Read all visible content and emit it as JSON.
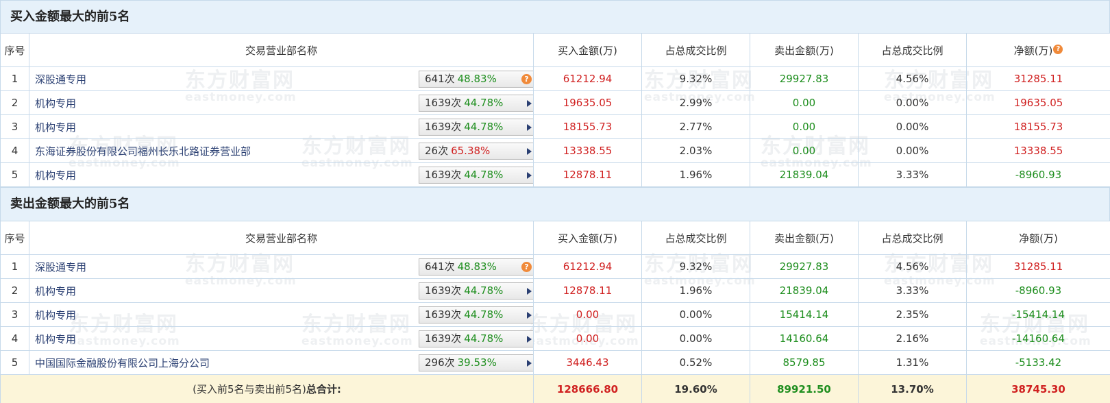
{
  "watermark": {
    "cn": "东方财富网",
    "en": "eastmoney.com"
  },
  "columns": [
    "序号",
    "交易营业部名称",
    "买入金额(万)",
    "占总成交比例",
    "卖出金额(万)",
    "占总成交比例",
    "净额(万)"
  ],
  "buy_section": {
    "title": "买入金额最大的前5名",
    "rows": [
      {
        "idx": "1",
        "name": "深股通专用",
        "count": "641次",
        "pct": "48.83%",
        "pct_color": "green",
        "icon": "question-icon",
        "buy": "61212.94",
        "buy_ratio": "9.32%",
        "sell": "29927.83",
        "sell_ratio": "4.56%",
        "net": "31285.11",
        "net_color": "red"
      },
      {
        "idx": "2",
        "name": "机构专用",
        "count": "1639次",
        "pct": "44.78%",
        "pct_color": "green",
        "icon": "arrow-right-icon",
        "buy": "19635.05",
        "buy_ratio": "2.99%",
        "sell": "0.00",
        "sell_ratio": "0.00%",
        "net": "19635.05",
        "net_color": "red"
      },
      {
        "idx": "3",
        "name": "机构专用",
        "count": "1639次",
        "pct": "44.78%",
        "pct_color": "green",
        "icon": "arrow-right-icon",
        "buy": "18155.73",
        "buy_ratio": "2.77%",
        "sell": "0.00",
        "sell_ratio": "0.00%",
        "net": "18155.73",
        "net_color": "red"
      },
      {
        "idx": "4",
        "name": "东海证券股份有限公司福州长乐北路证券营业部",
        "count": "26次",
        "pct": "65.38%",
        "pct_color": "red",
        "icon": "arrow-right-icon",
        "buy": "13338.55",
        "buy_ratio": "2.03%",
        "sell": "0.00",
        "sell_ratio": "0.00%",
        "net": "13338.55",
        "net_color": "red"
      },
      {
        "idx": "5",
        "name": "机构专用",
        "count": "1639次",
        "pct": "44.78%",
        "pct_color": "green",
        "icon": "arrow-right-icon",
        "buy": "12878.11",
        "buy_ratio": "1.96%",
        "sell": "21839.04",
        "sell_ratio": "3.33%",
        "net": "-8960.93",
        "net_color": "green"
      }
    ]
  },
  "sell_section": {
    "title": "卖出金额最大的前5名",
    "rows": [
      {
        "idx": "1",
        "name": "深股通专用",
        "count": "641次",
        "pct": "48.83%",
        "pct_color": "green",
        "icon": "question-icon",
        "buy": "61212.94",
        "buy_ratio": "9.32%",
        "sell": "29927.83",
        "sell_ratio": "4.56%",
        "net": "31285.11",
        "net_color": "red"
      },
      {
        "idx": "2",
        "name": "机构专用",
        "count": "1639次",
        "pct": "44.78%",
        "pct_color": "green",
        "icon": "arrow-right-icon",
        "buy": "12878.11",
        "buy_ratio": "1.96%",
        "sell": "21839.04",
        "sell_ratio": "3.33%",
        "net": "-8960.93",
        "net_color": "green"
      },
      {
        "idx": "3",
        "name": "机构专用",
        "count": "1639次",
        "pct": "44.78%",
        "pct_color": "green",
        "icon": "arrow-right-icon",
        "buy": "0.00",
        "buy_ratio": "0.00%",
        "sell": "15414.14",
        "sell_ratio": "2.35%",
        "net": "-15414.14",
        "net_color": "green"
      },
      {
        "idx": "4",
        "name": "机构专用",
        "count": "1639次",
        "pct": "44.78%",
        "pct_color": "green",
        "icon": "arrow-right-icon",
        "buy": "0.00",
        "buy_ratio": "0.00%",
        "sell": "14160.64",
        "sell_ratio": "2.16%",
        "net": "-14160.64",
        "net_color": "green"
      },
      {
        "idx": "5",
        "name": "中国国际金融股份有限公司上海分公司",
        "count": "296次",
        "pct": "39.53%",
        "pct_color": "green",
        "icon": "arrow-right-icon",
        "buy": "3446.43",
        "buy_ratio": "0.52%",
        "sell": "8579.85",
        "sell_ratio": "1.31%",
        "net": "-5133.42",
        "net_color": "green"
      }
    ]
  },
  "total": {
    "label_prefix": "(买入前5名与卖出前5名)",
    "label_bold": "总合计:",
    "buy": "128666.80",
    "buy_ratio": "19.60%",
    "sell": "89921.50",
    "sell_ratio": "13.70%",
    "net": "38745.30"
  },
  "colors": {
    "up": "#d02020",
    "down": "#1e8e1e",
    "header_bg": "#e6f1fa",
    "border": "#c6d9ea",
    "total_bg": "#fcf5d9",
    "help_icon": "#f08a3a"
  }
}
